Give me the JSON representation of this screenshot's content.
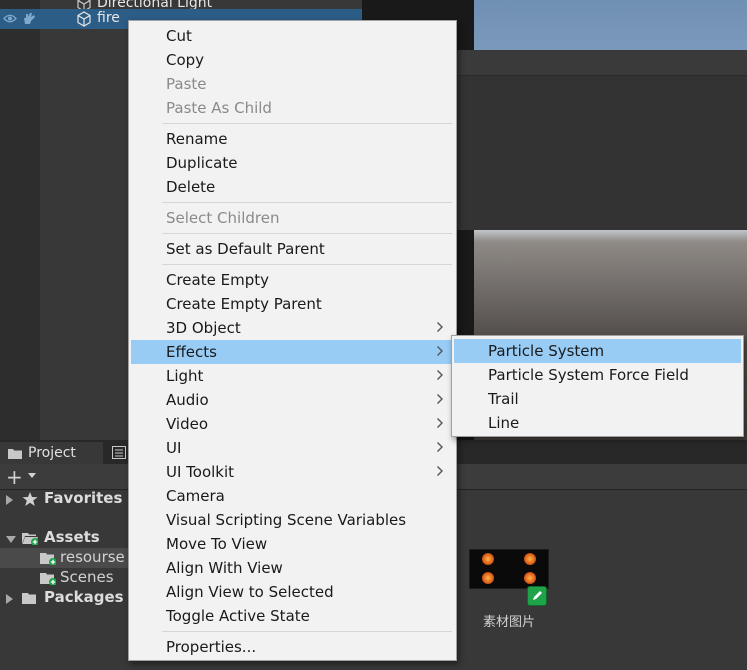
{
  "hierarchy": {
    "items": [
      {
        "name": "Directional Light"
      },
      {
        "name": "fire"
      }
    ]
  },
  "project_panel": {
    "tab_label": "Project",
    "tree": {
      "favorites": "Favorites",
      "assets": "Assets",
      "resourse": "resourse",
      "scenes": "Scenes",
      "packages": "Packages"
    },
    "asset": {
      "label": "素材图片"
    }
  },
  "context_menu": {
    "cut": "Cut",
    "copy": "Copy",
    "paste": "Paste",
    "paste_as_child": "Paste As Child",
    "rename": "Rename",
    "duplicate": "Duplicate",
    "delete": "Delete",
    "select_children": "Select Children",
    "set_default_parent": "Set as Default Parent",
    "create_empty": "Create Empty",
    "create_empty_parent": "Create Empty Parent",
    "object_3d": "3D Object",
    "effects": "Effects",
    "light": "Light",
    "audio": "Audio",
    "video": "Video",
    "ui": "UI",
    "ui_toolkit": "UI Toolkit",
    "camera": "Camera",
    "visual_scripting": "Visual Scripting Scene Variables",
    "move_to_view": "Move To View",
    "align_with_view": "Align With View",
    "align_view_to_selected": "Align View to Selected",
    "toggle_active": "Toggle Active State",
    "properties": "Properties..."
  },
  "effects_submenu": {
    "particle_system": "Particle System",
    "particle_force_field": "Particle System Force Field",
    "trail": "Trail",
    "line": "Line"
  },
  "colors": {
    "menu_highlight": "#99ccf5",
    "selection": "#2c5d87",
    "badge_green": "#1fa34a"
  }
}
